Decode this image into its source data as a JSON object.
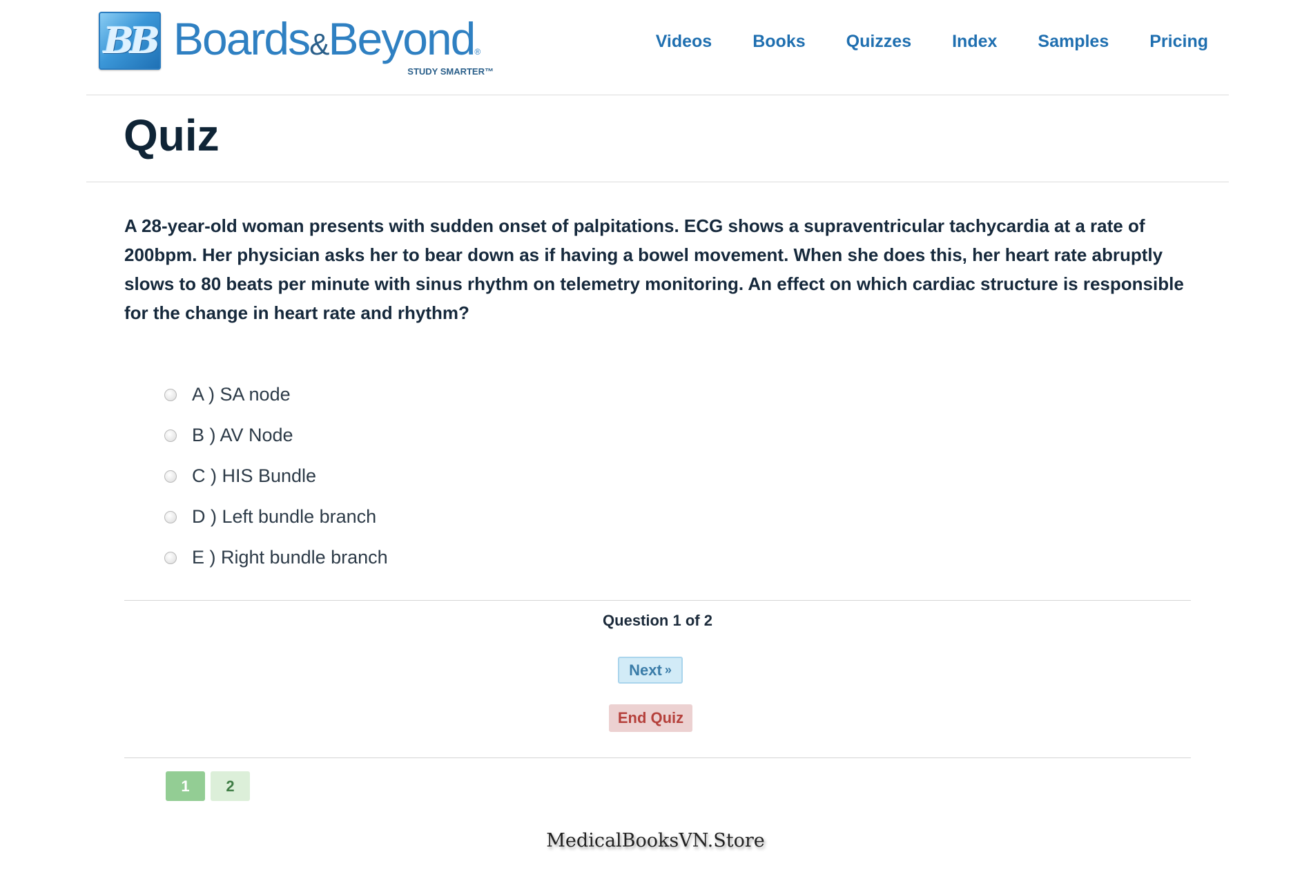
{
  "brand": {
    "logo_mark": "BB",
    "name_part1": "Boards",
    "name_amp": "&",
    "name_part2": "Beyond",
    "registered": "®",
    "tagline": "STUDY SMARTER™"
  },
  "nav": {
    "items": [
      {
        "label": "Videos"
      },
      {
        "label": "Books"
      },
      {
        "label": "Quizzes"
      },
      {
        "label": "Index"
      },
      {
        "label": "Samples"
      },
      {
        "label": "Pricing"
      }
    ]
  },
  "page": {
    "title": "Quiz"
  },
  "quiz": {
    "question": "A 28-year-old woman presents with sudden onset of palpitations. ECG shows a supraventricular tachycardia at a rate of 200bpm. Her physician asks her to bear down as if having a bowel movement. When she does this, her heart rate abruptly slows to 80 beats per minute with sinus rhythm on telemetry monitoring. An effect on which cardiac structure is responsible for the change in heart rate and rhythm?",
    "options": [
      {
        "label": "A ) SA node"
      },
      {
        "label": "B ) AV Node"
      },
      {
        "label": "C ) HIS Bundle"
      },
      {
        "label": "D ) Left bundle branch"
      },
      {
        "label": "E ) Right bundle branch"
      }
    ],
    "progress": "Question 1 of 2",
    "next_label": "Next",
    "next_glyph": "»",
    "end_label": "End Quiz",
    "pages": [
      {
        "label": "1",
        "active": true
      },
      {
        "label": "2",
        "active": false
      }
    ]
  },
  "watermark": "MedicalBooksVN.Store",
  "colors": {
    "nav_link": "#1f6fb0",
    "title": "#0f2436",
    "next_bg": "#d2ebf7",
    "end_bg": "#ecd1d1",
    "end_text": "#b5403b",
    "page_active": "#93cd94",
    "page_inactive": "#dcefd9"
  }
}
